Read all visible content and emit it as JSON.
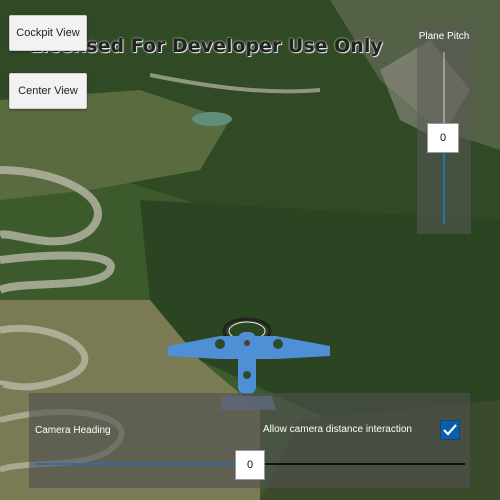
{
  "watermark": "Licensed For Developer Use Only",
  "buttons": {
    "cockpit_view": "Cockpit View",
    "center_view": "Center View"
  },
  "pitch": {
    "label": "Plane Pitch",
    "value": "0",
    "level": 0.5
  },
  "camera": {
    "heading_label": "Camera Heading",
    "heading_value": "0",
    "heading_level": 0.5,
    "distance_label": "Allow camera distance interaction",
    "distance_checked": true
  },
  "colors": {
    "accent": "#2a6fb0",
    "checkbox": "#0a5fa8",
    "plane": "#4f8fd6"
  }
}
